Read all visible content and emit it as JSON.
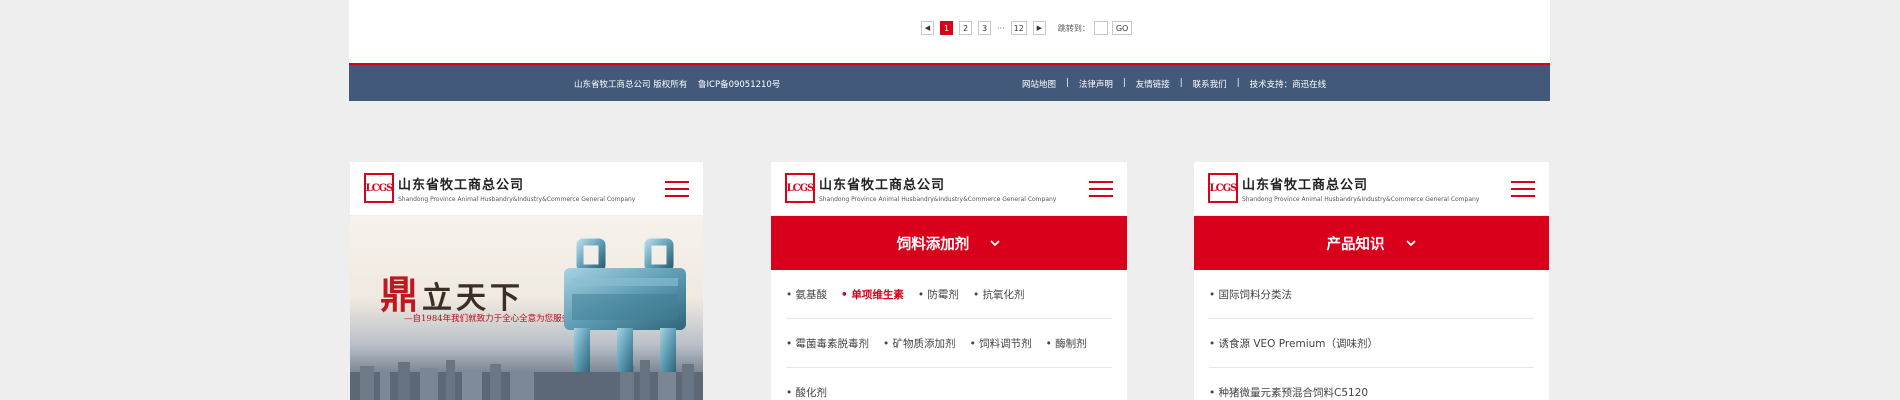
{
  "pagination": {
    "prev": "◀",
    "pages": [
      "1",
      "2",
      "3"
    ],
    "active_page": "1",
    "ellipsis": "···",
    "last_page": "12",
    "next": "▶",
    "jump_label": "跳转到：",
    "go_label": "GO"
  },
  "footer": {
    "copyright": "山东省牧工商总公司 版权所有",
    "icp": "鲁ICP备09051210号",
    "links": [
      "网站地图",
      "法律声明",
      "友情链接",
      "联系我们",
      "技术支持：商迅在线"
    ],
    "separator": "|"
  },
  "brand": {
    "mark": "LCGS",
    "name_cn": "山东省牧工商总公司",
    "name_en": "Shandong Province Animal Husbandry&Industry&Commerce General Company"
  },
  "banner": {
    "slogan_first": "鼎",
    "slogan_rest": "立天下",
    "subslogan": "—自1984年我们就致力于全心全意为您服务"
  },
  "card2": {
    "section_title": "饲料添加剂",
    "rows": [
      [
        "• 氨基酸",
        "• 单项维生素",
        "• 防霉剂",
        "• 抗氧化剂"
      ],
      [
        "• 霉菌毒素脱毒剂",
        "• 矿物质添加剂",
        "• 饲料调节剂",
        "• 酶制剂"
      ],
      [
        "• 酸化剂"
      ]
    ],
    "active_item": "• 单项维生素"
  },
  "card3": {
    "section_title": "产品知识",
    "items": [
      "• 国际饲料分类法",
      "• 诱食源 VEO Premium（调味剂）",
      "• 种猪微量元素预混合饲料C5120"
    ]
  },
  "colors": {
    "brand_red": "#d9001b",
    "footer_blue": "#42597a",
    "background": "#eeeeee"
  },
  "icons": [
    "prev-arrow-icon",
    "next-arrow-icon",
    "menu-icon",
    "chevron-down-icon",
    "logo-icon"
  ]
}
